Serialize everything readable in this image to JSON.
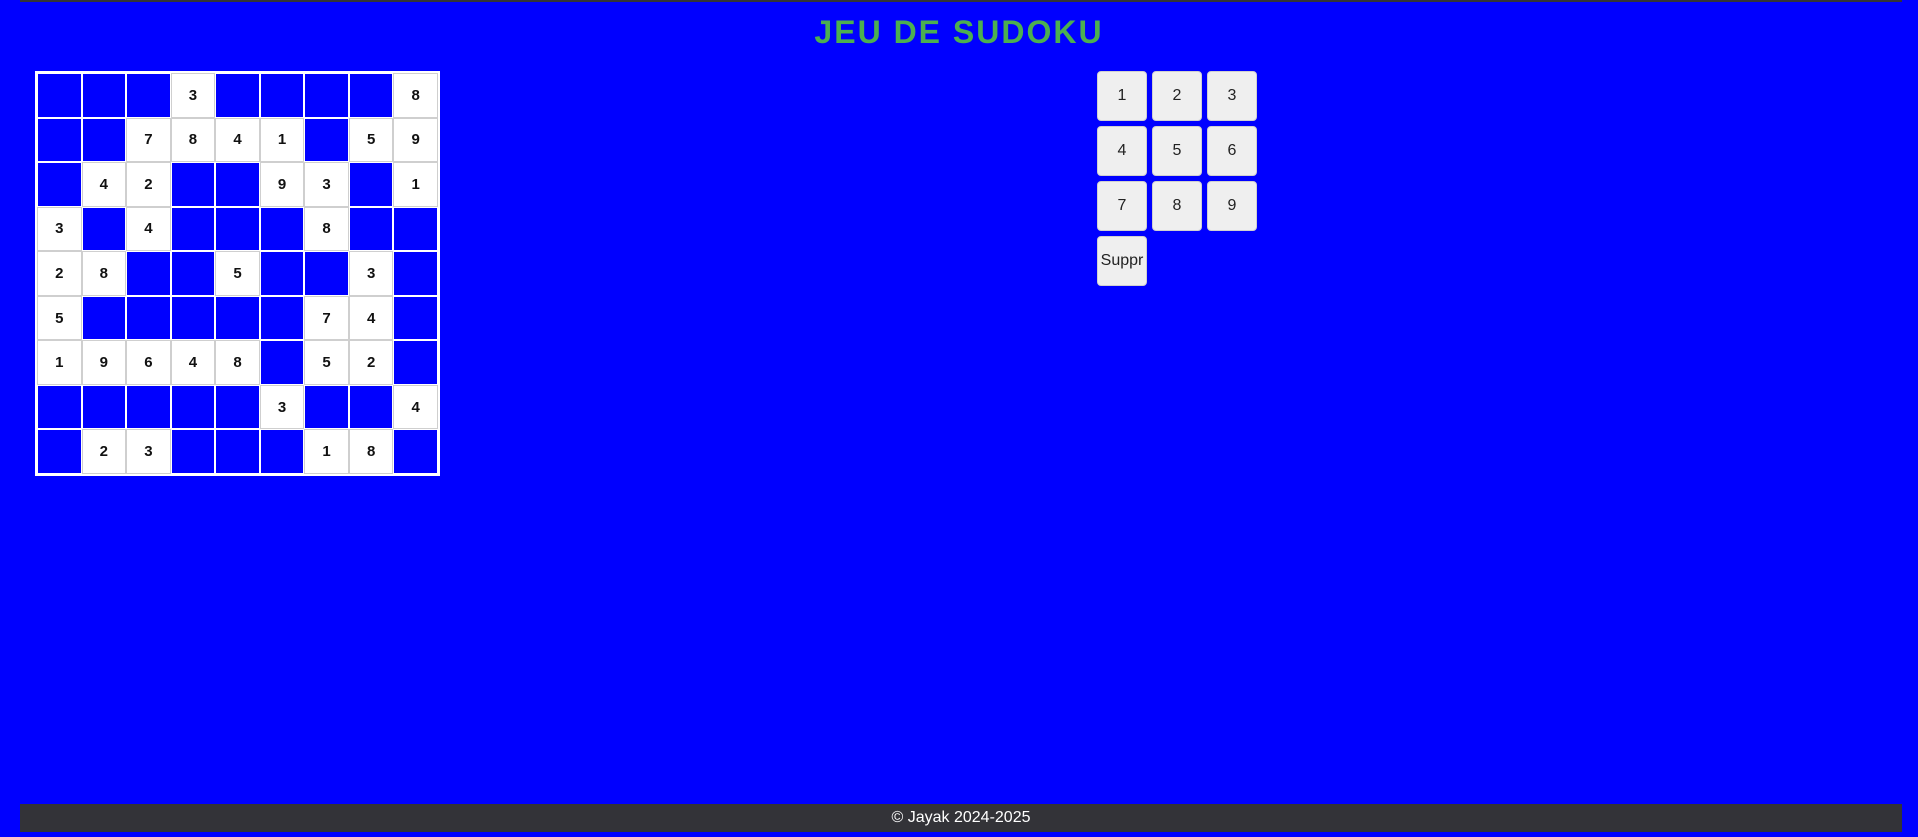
{
  "title": "JEU DE SUDOKU",
  "grid": [
    [
      "",
      "",
      "",
      "3",
      "",
      "",
      "",
      "",
      "8"
    ],
    [
      "",
      "",
      "7",
      "8",
      "4",
      "1",
      "",
      "5",
      "9"
    ],
    [
      "",
      "4",
      "2",
      "",
      "",
      "9",
      "3",
      "",
      "1"
    ],
    [
      "3",
      "",
      "4",
      "",
      "",
      "",
      "8",
      "",
      ""
    ],
    [
      "2",
      "8",
      "",
      "",
      "5",
      "",
      "",
      "3",
      ""
    ],
    [
      "5",
      "",
      "",
      "",
      "",
      "",
      "7",
      "4",
      ""
    ],
    [
      "1",
      "9",
      "6",
      "4",
      "8",
      "",
      "5",
      "2",
      ""
    ],
    [
      "",
      "",
      "",
      "",
      "",
      "3",
      "",
      "",
      "4"
    ],
    [
      "",
      "2",
      "3",
      "",
      "",
      "",
      "1",
      "8",
      ""
    ]
  ],
  "keypad": {
    "keys": [
      "1",
      "2",
      "3",
      "4",
      "5",
      "6",
      "7",
      "8",
      "9"
    ],
    "delete_label": "Suppr"
  },
  "footer": {
    "text": "© Jayak 2024-2025"
  },
  "colors": {
    "background": "#0000ff",
    "title": "#4caf50",
    "footer_bg": "#333338",
    "empty_cell": "#0000ff",
    "filled_cell": "#ffffff",
    "key_bg": "#efefef"
  }
}
